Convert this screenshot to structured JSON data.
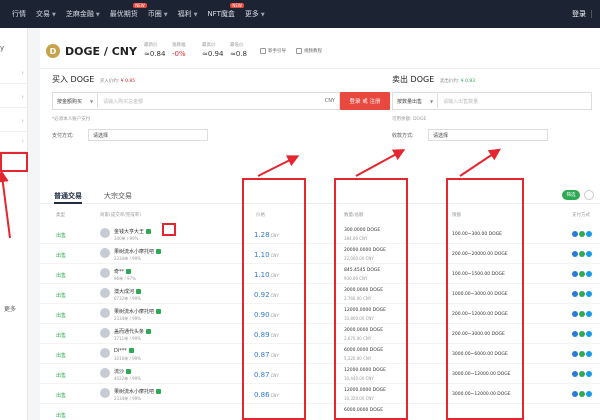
{
  "nav": {
    "items": [
      {
        "label": "行情",
        "caret": false,
        "badge": ""
      },
      {
        "label": "交易",
        "caret": true,
        "badge": ""
      },
      {
        "label": "芝麻金融",
        "caret": true,
        "badge": ""
      },
      {
        "label": "最优期货",
        "caret": false,
        "badge": "NEW"
      },
      {
        "label": "币圈",
        "caret": true,
        "badge": ""
      },
      {
        "label": "福利",
        "caret": true,
        "badge": ""
      },
      {
        "label": "NFT魔盒",
        "caret": false,
        "badge": "NEW"
      },
      {
        "label": "更多",
        "caret": true,
        "badge": ""
      }
    ],
    "login": "登录"
  },
  "sidebar": {
    "top_label": "y",
    "more_label": "更多"
  },
  "pair": {
    "logo_letter": "D",
    "title": "DOGE / CNY",
    "stats": [
      {
        "label": "最新价",
        "value": "≈0.84",
        "red": false
      },
      {
        "label": "涨跌幅",
        "value": "-0%",
        "red": true
      },
      {
        "label": "最高价",
        "value": "≈0.94",
        "red": false
      },
      {
        "label": "最低价",
        "value": "≈0.8",
        "red": false
      }
    ],
    "links": [
      "新手引导",
      "视频教程"
    ]
  },
  "buy": {
    "title": "买入 DOGE",
    "ref_label": "买入价约:",
    "ref_price": "¥ 0.85",
    "mode": "按金额购买",
    "placeholder": "请输入购买总金额",
    "unit": "CNY",
    "button": "登录 或 注册",
    "note": "*必须本人账户支付",
    "pay_label": "支付方式:",
    "pay_value": "请选择"
  },
  "sell": {
    "title": "卖出 DOGE",
    "ref_label": "卖出价约:",
    "ref_price": "¥ 0.83",
    "mode": "按数量出售",
    "placeholder": "请输入出售数量",
    "available": "可用余额: DOGE",
    "pay_label": "收款方式:",
    "pay_value": "请选择"
  },
  "tabs": {
    "normal": "普通交易",
    "bulk": "大宗交易",
    "right_button": "筛选"
  },
  "table": {
    "headers": {
      "type": "类型",
      "merchant": "商家(成交单/完成率)",
      "price": "价格",
      "qty": "数量/总额",
      "limit": "限额",
      "pay": "支付方式"
    },
    "rows": [
      {
        "type": "出售",
        "name": "金钱大亨大王",
        "sub": "340单 / 99%",
        "price": "1.28",
        "qty": "300.0000 DOGE",
        "total": "384.00 CNY",
        "limit": "100.00~300.00 DOGE"
      },
      {
        "type": "出售",
        "name": "果树流水小摩托吧",
        "sub": "2334单 / 99%",
        "price": "1.10",
        "qty": "20000.0000 DOGE",
        "total": "22,000.00 CNY",
        "limit": "200.00~20000.00 DOGE"
      },
      {
        "type": "出售",
        "name": "奇**",
        "sub": "96单 / 97%",
        "price": "1.10",
        "qty": "845.4545 DOGE",
        "total": "930.00 CNY",
        "limit": "100.00~1500.00 DOGE"
      },
      {
        "type": "出售",
        "name": "澳大成河",
        "sub": "6732单 / 99%",
        "price": "0.92",
        "qty": "3000.0000 DOGE",
        "total": "2,760.00 CNY",
        "limit": "1000.00~3000.00 DOGE"
      },
      {
        "type": "出售",
        "name": "果树流水小摩托吧",
        "sub": "2334单 / 99%",
        "price": "0.90",
        "qty": "12000.0000 DOGE",
        "total": "10,800.00 CNY",
        "limit": "200.00~12000.00 DOGE"
      },
      {
        "type": "出售",
        "name": "盖而通代头条",
        "sub": "3711单 / 99%",
        "price": "0.89",
        "qty": "3000.0000 DOGE",
        "total": "2,670.00 CNY",
        "limit": "200.00~3000.00 DOGE"
      },
      {
        "type": "出售",
        "name": "Di***",
        "sub": "3016单 / 99%",
        "price": "0.87",
        "qty": "6000.0000 DOGE",
        "total": "5,220.00 CNY",
        "limit": "3000.00~6000.00 DOGE"
      },
      {
        "type": "出售",
        "name": "流沙",
        "sub": "4022单 / 99%",
        "price": "0.87",
        "qty": "12000.0000 DOGE",
        "total": "10,440.00 CNY",
        "limit": "3000.00~12000.00 DOGE"
      },
      {
        "type": "出售",
        "name": "果树流水小摩托吧",
        "sub": "2334单 / 99%",
        "price": "0.86",
        "qty": "12000.0000 DOGE",
        "total": "10,320.00 CNY",
        "limit": "3000.00~12000.00 DOGE"
      },
      {
        "type": "出售",
        "name": "",
        "sub": "",
        "price": "",
        "qty": "6000.0000 DOGE",
        "total": "",
        "limit": ""
      }
    ],
    "price_unit": "CNY"
  },
  "colors": {
    "accent_red": "#e3262f",
    "buy_green": "#2eaa54",
    "price_blue": "#2e7ad1",
    "nav_bg": "#1c2433"
  }
}
